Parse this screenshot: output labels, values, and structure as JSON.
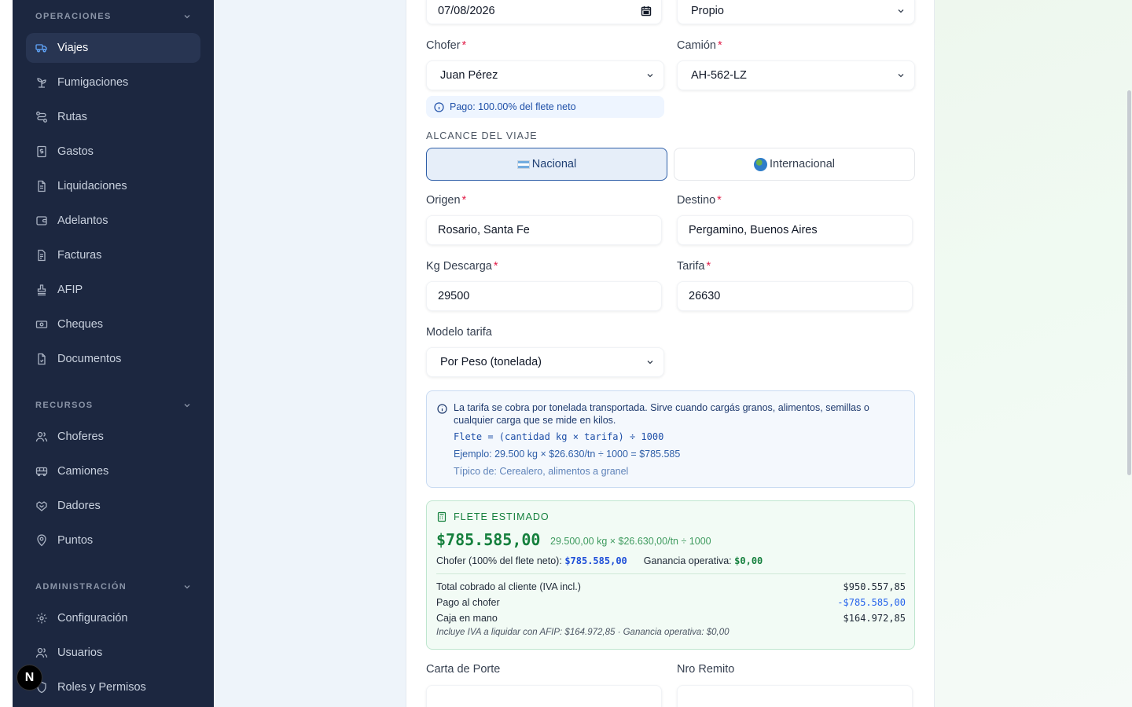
{
  "sidebar": {
    "sections": [
      {
        "title": "OPERACIONES"
      },
      {
        "title": "RECURSOS"
      },
      {
        "title": "ADMINISTRACIÓN"
      }
    ],
    "items": [
      {
        "label": "Viajes",
        "icon": "truck-icon"
      },
      {
        "label": "Fumigaciones",
        "icon": "sprout-icon"
      },
      {
        "label": "Rutas",
        "icon": "route-icon"
      },
      {
        "label": "Gastos",
        "icon": "receipt-icon"
      },
      {
        "label": "Liquidaciones",
        "icon": "file-text-icon"
      },
      {
        "label": "Adelantos",
        "icon": "wallet-icon"
      },
      {
        "label": "Facturas",
        "icon": "invoice-icon"
      },
      {
        "label": "AFIP",
        "icon": "stamp-icon"
      },
      {
        "label": "Cheques",
        "icon": "banknote-icon"
      },
      {
        "label": "Documentos",
        "icon": "file-icon"
      },
      {
        "label": "Choferes",
        "icon": "users-icon"
      },
      {
        "label": "Camiones",
        "icon": "bus-icon"
      },
      {
        "label": "Dadores",
        "icon": "handshake-icon"
      },
      {
        "label": "Puntos",
        "icon": "map-pin-icon"
      },
      {
        "label": "Configuración",
        "icon": "gear-icon"
      },
      {
        "label": "Usuarios",
        "icon": "users-icon"
      },
      {
        "label": "Roles y Permisos",
        "icon": "shield-icon"
      }
    ],
    "badge": "N"
  },
  "form": {
    "date_value": "07/08/2026",
    "ownership_value": "Propio",
    "chofer_label": "Chofer",
    "chofer_value": "Juan Pérez",
    "camion_label": "Camión",
    "camion_value": "AH-562-LZ",
    "pago_note": "Pago: 100.00% del flete neto",
    "alcance_label": "ALCANCE DEL VIAJE",
    "nacional_label": "Nacional",
    "internacional_label": "Internacional",
    "origen_label": "Origen",
    "origen_value": "Rosario, Santa Fe",
    "destino_label": "Destino",
    "destino_value": "Pergamino, Buenos Aires",
    "kg_label": "Kg Descarga",
    "kg_value": "29500",
    "tarifa_label": "Tarifa",
    "tarifa_value": "26630",
    "modelo_label": "Modelo tarifa",
    "modelo_value": "Por Peso (tonelada)",
    "carta_label": "Carta de Porte",
    "remito_label": "Nro Remito",
    "required_mark": "*"
  },
  "info": {
    "text": "La tarifa se cobra por tonelada transportada. Sirve cuando cargás granos, alimentos, semillas o cualquier carga que se mide en kilos.",
    "formula": "Flete = (cantidad kg × tarifa) ÷ 1000",
    "example": "Ejemplo: 29.500 kg × $26.630/tn ÷ 1000 = $785.585",
    "typical": "Típico de: Cerealero, alimentos a granel"
  },
  "estimate": {
    "caption": "FLETE ESTIMADO",
    "amount": "$785.585,00",
    "formula": "29.500,00 kg × $26.630,00/tn ÷ 1000",
    "chofer_text": "Chofer (100% del flete neto):",
    "chofer_amount": "$785.585,00",
    "ganancia_text": "Ganancia operativa:",
    "ganancia_amount": "$0,00",
    "rows": [
      {
        "label": "Total cobrado al cliente (IVA incl.)",
        "value": "$950.557,85"
      },
      {
        "label": "Pago al chofer",
        "value": "-$785.585,00"
      },
      {
        "label": "Caja en mano",
        "value": "$164.972,85"
      }
    ],
    "footnote": "Incluye IVA a liquidar con AFIP: $164.972,85 · Ganancia operativa: $0,00"
  },
  "colors": {
    "sidebar_bg": "#1c2740",
    "accent_blue": "#2f5fa8",
    "success_green": "#15803d",
    "required_red": "#e11d48"
  }
}
